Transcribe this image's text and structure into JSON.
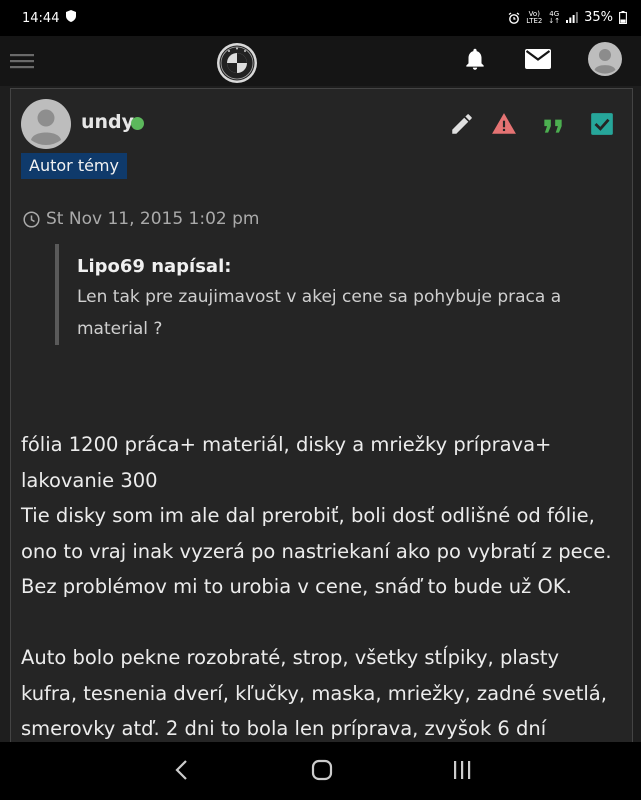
{
  "status_bar": {
    "time": "14:44",
    "volte_line1": "Vo)",
    "volte_line2": "LTE2",
    "network": "4G",
    "network_sub": "↓↑",
    "battery": "35%"
  },
  "post": {
    "author": "undy",
    "author_status": "online",
    "role_badge": "Autor témy",
    "posted_at": "St Nov 11, 2015 1:02 pm",
    "quote": {
      "author": "Lipo69 napísal:",
      "text": "Len tak pre zaujimavost v akej cene sa pohybuje praca a material ?"
    },
    "body": {
      "line1": "fólia 1200 práca+ materiál, disky a mriežky príprava+ lakovanie 300",
      "line2": "Tie disky som im ale dal prerobiť, boli dosť odlišné od fólie, ono to vraj inak vyzerá po nastriekaní ako po vybratí z pece. Bez problémov mi to urobia v cene, snáď to bude už OK.",
      "line3": "Auto bolo pekne rozobraté, strop, všetky stĺpiky, plasty kufra, tesnenia dverí, kľučky, maska, mriežky, zadné svetlá, smerovky atď. 2 dni to bola len príprava, zvyšok 6 dní"
    }
  },
  "colors": {
    "background": "#1e1e1e",
    "post_background": "#252525",
    "badge": "#0f3a6b",
    "online": "#5cb85c",
    "report": "#e57373",
    "quote_action": "#4caf50",
    "approve": "#26a69a"
  },
  "icons": [
    "menu-icon",
    "logo",
    "bell-icon",
    "mail-icon",
    "user-avatar",
    "edit-icon",
    "warning-icon",
    "quote-icon",
    "checkbox-icon",
    "clock-icon",
    "back-icon",
    "home-icon",
    "recent-apps-icon"
  ]
}
